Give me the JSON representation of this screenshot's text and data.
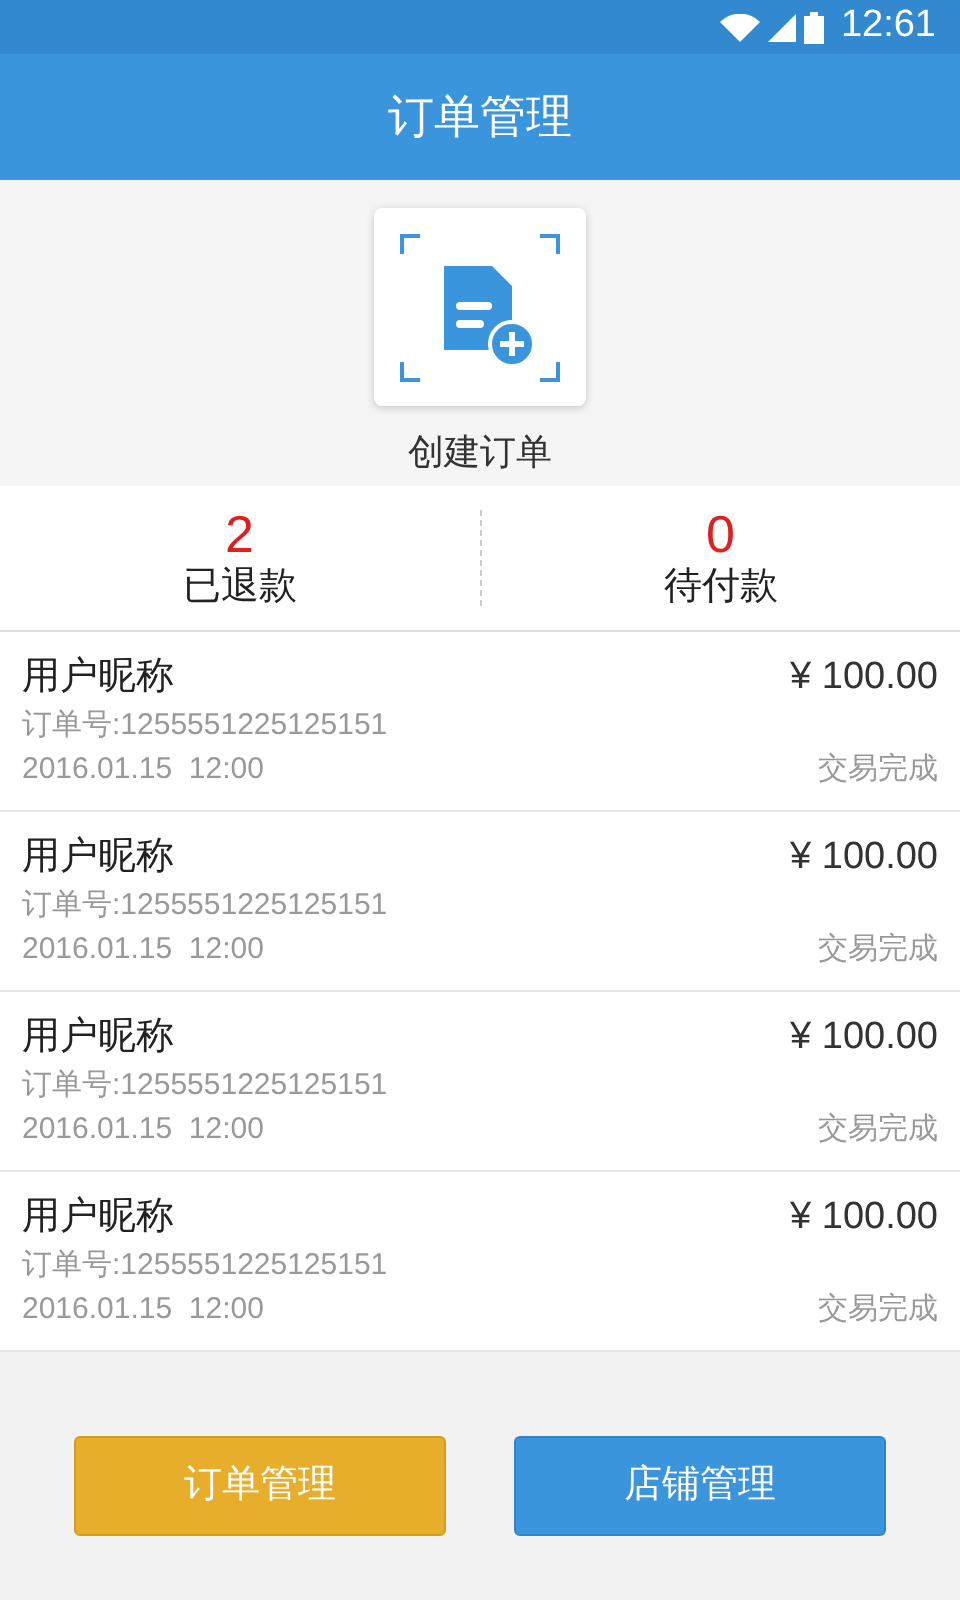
{
  "status_bar": {
    "time": "12:61"
  },
  "header": {
    "title": "订单管理"
  },
  "create": {
    "label": "创建订单"
  },
  "stats": [
    {
      "value": "2",
      "label": "已退款"
    },
    {
      "value": "0",
      "label": "待付款"
    }
  ],
  "orders": [
    {
      "name": "用户昵称",
      "amount": "¥ 100.00",
      "order_no": "订单号:1255551225125151",
      "time": "2016.01.15  12:00",
      "status": "交易完成"
    },
    {
      "name": "用户昵称",
      "amount": "¥ 100.00",
      "order_no": "订单号:1255551225125151",
      "time": "2016.01.15  12:00",
      "status": "交易完成"
    },
    {
      "name": "用户昵称",
      "amount": "¥ 100.00",
      "order_no": "订单号:1255551225125151",
      "time": "2016.01.15  12:00",
      "status": "交易完成"
    },
    {
      "name": "用户昵称",
      "amount": "¥ 100.00",
      "order_no": "订单号:1255551225125151",
      "time": "2016.01.15  12:00",
      "status": "交易完成"
    }
  ],
  "buttons": [
    {
      "label": "订单管理",
      "kind": "primary"
    },
    {
      "label": "店铺管理",
      "kind": "secondary"
    }
  ]
}
